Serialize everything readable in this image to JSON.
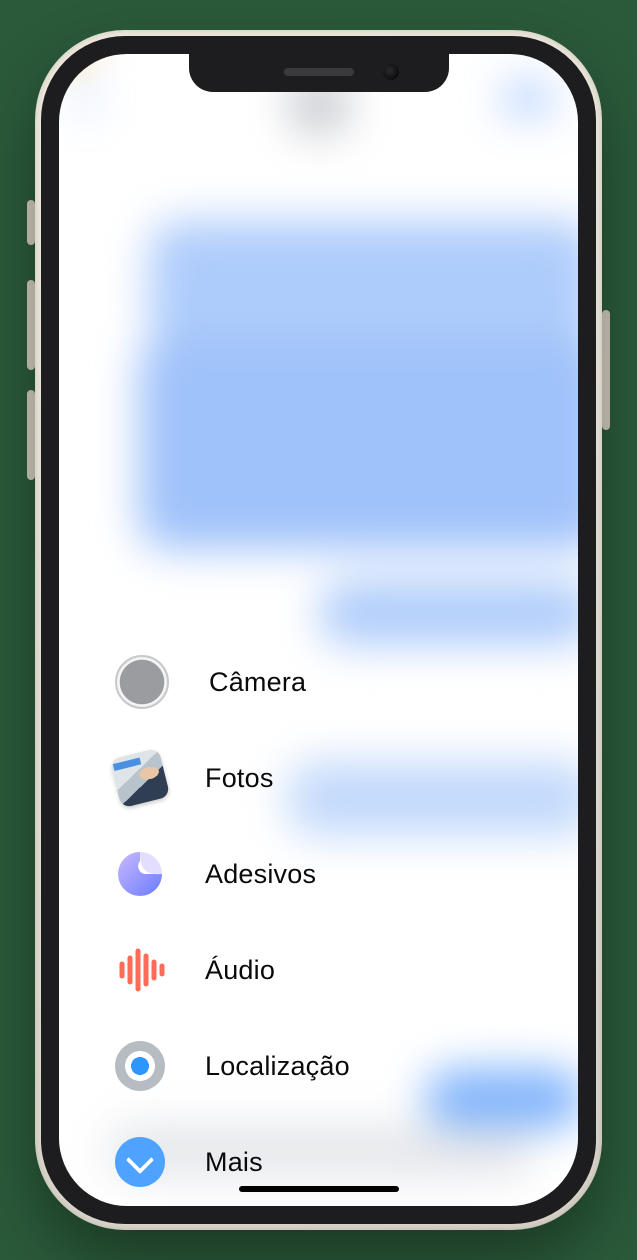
{
  "menu": {
    "items": [
      {
        "id": "camera",
        "label": "Câmera"
      },
      {
        "id": "photos",
        "label": "Fotos"
      },
      {
        "id": "stickers",
        "label": "Adesivos"
      },
      {
        "id": "audio",
        "label": "Áudio"
      },
      {
        "id": "location",
        "label": "Localização"
      },
      {
        "id": "more",
        "label": "Mais"
      }
    ]
  }
}
